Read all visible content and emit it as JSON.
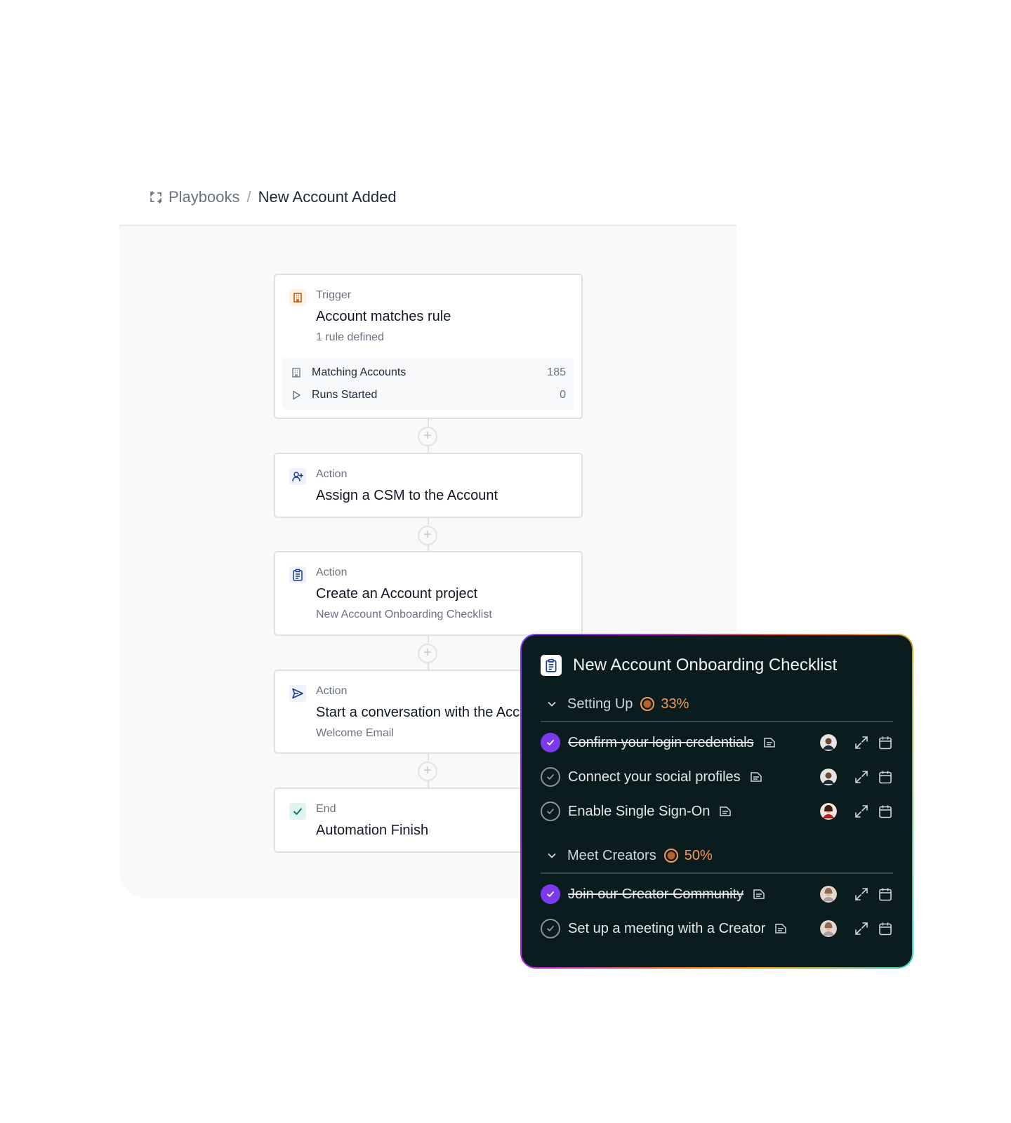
{
  "breadcrumb": {
    "root": "Playbooks",
    "separator": "/",
    "current": "New Account Added"
  },
  "nodes": {
    "trigger": {
      "kind": "Trigger",
      "title": "Account matches rule",
      "subtitle": "1 rule defined",
      "icon": "building-icon",
      "stats": [
        {
          "label": "Matching Accounts",
          "value": "185",
          "icon": "building-icon"
        },
        {
          "label": "Runs Started",
          "value": "0",
          "icon": "play-icon"
        }
      ]
    },
    "assign": {
      "kind": "Action",
      "title": "Assign a CSM to the Account",
      "icon": "user-plus-icon"
    },
    "project": {
      "kind": "Action",
      "title": "Create an Account project",
      "subtitle": "New Account Onboarding Checklist",
      "icon": "clipboard-icon"
    },
    "conversation": {
      "kind": "Action",
      "title": "Start a conversation with the Account",
      "subtitle": "Welcome Email",
      "icon": "send-icon"
    },
    "end": {
      "kind": "End",
      "title": "Automation Finish",
      "icon": "check-icon"
    }
  },
  "checklist": {
    "title": "New Account Onboarding Checklist",
    "sections": [
      {
        "title": "Setting Up",
        "progress": "33%",
        "tasks": [
          {
            "label": "Confirm your login credentials",
            "done": true
          },
          {
            "label": "Connect your social profiles",
            "done": false
          },
          {
            "label": "Enable Single Sign-On",
            "done": false
          }
        ]
      },
      {
        "title": "Meet Creators",
        "progress": "50%",
        "tasks": [
          {
            "label": "Join our Creator Community",
            "done": true
          },
          {
            "label": "Set up a meeting with a Creator",
            "done": false
          }
        ]
      }
    ]
  },
  "colors": {
    "accent_purple": "#7c3aed",
    "progress_orange": "#f59a52",
    "panel_bg": "#0b1c1f",
    "canvas_bg": "#f9f9fa"
  }
}
